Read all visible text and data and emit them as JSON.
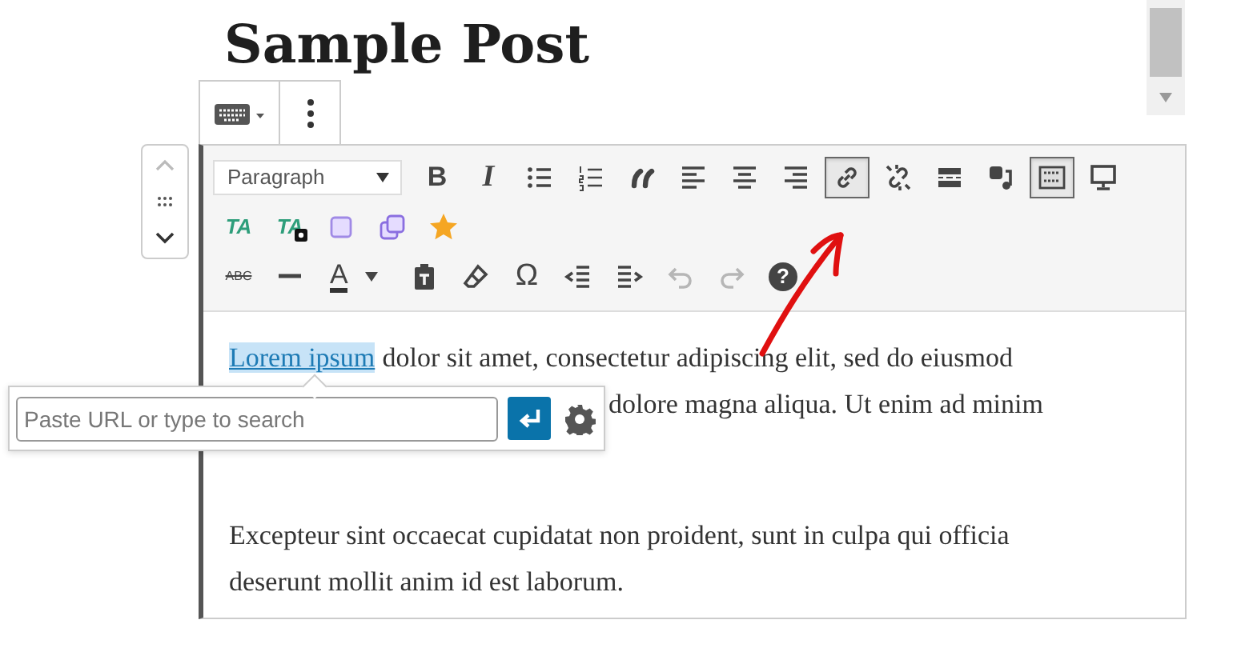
{
  "post_title": "Sample Post",
  "toolbar": {
    "format": "Paragraph",
    "rows": [
      [
        {
          "kind": "bold",
          "label": "B",
          "pressed": false,
          "disabled": false
        },
        {
          "kind": "italic",
          "label": "I",
          "pressed": false,
          "disabled": false
        },
        {
          "kind": "bullet-list",
          "pressed": false,
          "disabled": false
        },
        {
          "kind": "numbered-list",
          "pressed": false,
          "disabled": false
        },
        {
          "kind": "blockquote",
          "pressed": false,
          "disabled": false
        },
        {
          "kind": "align-left",
          "pressed": false,
          "disabled": false
        },
        {
          "kind": "align-center",
          "pressed": false,
          "disabled": false
        },
        {
          "kind": "align-right",
          "pressed": false,
          "disabled": false
        },
        {
          "kind": "link",
          "pressed": true,
          "disabled": false
        },
        {
          "kind": "unlink",
          "pressed": false,
          "disabled": false
        },
        {
          "kind": "read-more",
          "pressed": false,
          "disabled": false
        },
        {
          "kind": "media",
          "pressed": false,
          "disabled": false
        },
        {
          "kind": "toolbar-toggle",
          "pressed": true,
          "disabled": false
        },
        {
          "kind": "preview",
          "pressed": false,
          "disabled": false
        }
      ],
      [
        {
          "kind": "text-ta",
          "label": "TA",
          "pressed": false,
          "disabled": false
        },
        {
          "kind": "text-ta-badge",
          "label": "TA",
          "pressed": false,
          "disabled": false
        },
        {
          "kind": "box",
          "pressed": false,
          "disabled": false
        },
        {
          "kind": "boxes",
          "pressed": false,
          "disabled": false
        },
        {
          "kind": "star",
          "pressed": false,
          "disabled": false
        }
      ],
      [
        {
          "kind": "strikethrough",
          "label": "ABC",
          "pressed": false,
          "disabled": false
        },
        {
          "kind": "horizontal-line",
          "pressed": false,
          "disabled": false
        },
        {
          "kind": "text-color",
          "label": "A",
          "pressed": false,
          "disabled": false
        },
        {
          "kind": "paste-text",
          "pressed": false,
          "disabled": false
        },
        {
          "kind": "clear-formatting",
          "pressed": false,
          "disabled": false
        },
        {
          "kind": "special-character",
          "label": "Ω",
          "pressed": false,
          "disabled": false
        },
        {
          "kind": "outdent",
          "pressed": false,
          "disabled": false
        },
        {
          "kind": "indent",
          "pressed": false,
          "disabled": false
        },
        {
          "kind": "undo",
          "pressed": false,
          "disabled": true
        },
        {
          "kind": "redo",
          "pressed": false,
          "disabled": true
        },
        {
          "kind": "help",
          "label": "?",
          "pressed": false,
          "disabled": false
        }
      ]
    ]
  },
  "content": {
    "paragraph_1": {
      "link": "Lorem ipsum",
      "lines": [
        "dolor sit amet, consectetur adipiscing elit, sed do eiusmod",
        "dolore magna aliqua. Ut enim ad minim"
      ]
    },
    "paragraph_2": "Excepteur sint occaecat cupidatat non proident, sunt in culpa qui officia deserunt mollit anim id est laborum."
  },
  "link_popover": {
    "placeholder": "Paste URL or type to search"
  }
}
